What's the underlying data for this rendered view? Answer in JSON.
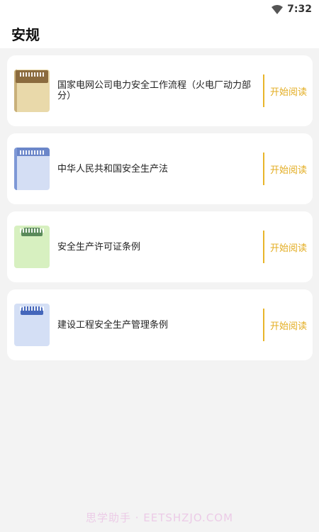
{
  "status": {
    "time": "7:32",
    "wifi_icon": "wifi-icon"
  },
  "header": {
    "title": "安规"
  },
  "books": [
    {
      "title": "国家电网公司电力安全工作流程（火电厂动力部分）",
      "action": "开始阅读",
      "cover_color": "#e9d9aa"
    },
    {
      "title": "中华人民共和国安全生产法",
      "action": "开始阅读",
      "cover_color": "#d4def4"
    },
    {
      "title": "安全生产许可证条例",
      "action": "开始阅读",
      "cover_color": "#d7f0c0"
    },
    {
      "title": "建设工程安全生产管理条例",
      "action": "开始阅读",
      "cover_color": "#d4dff5"
    }
  ],
  "colors": {
    "accent": "#e3ad22",
    "background": "#f3f3f3"
  },
  "watermark": "思学助手 · EETSHZJO.COM"
}
